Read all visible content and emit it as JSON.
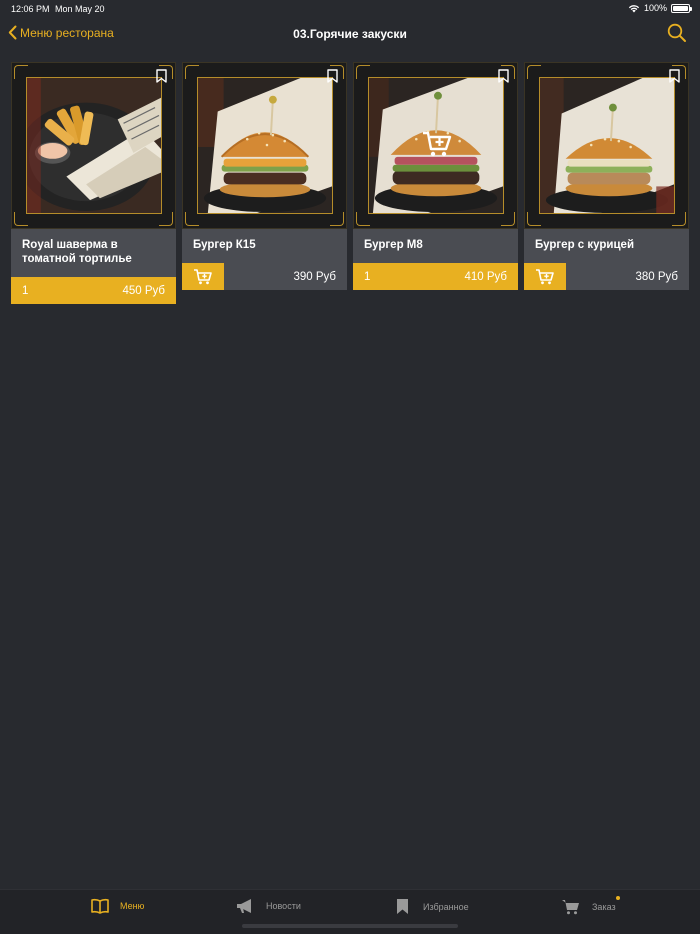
{
  "status_bar": {
    "time": "12:06 PM",
    "date": "Mon May 20",
    "battery": "100%"
  },
  "nav": {
    "back_label": "Меню ресторана",
    "title": "03.Горячие закуски"
  },
  "products": [
    {
      "name": "Royal шаверма в томатной тортилье",
      "quantity": "1",
      "price": "450 Руб",
      "in_cart": true,
      "image": "shawarma"
    },
    {
      "name": "Бургер К15",
      "quantity": "",
      "price": "390 Руб",
      "in_cart": false,
      "image": "burger"
    },
    {
      "name": "Бургер М8",
      "quantity": "1",
      "price": "410 Руб",
      "in_cart": true,
      "image": "burger"
    },
    {
      "name": "Бургер с курицей",
      "quantity": "",
      "price": "380 Руб",
      "in_cart": false,
      "image": "burger"
    }
  ],
  "tabs": [
    {
      "label": "Меню",
      "icon": "book-icon",
      "active": true
    },
    {
      "label": "Новости",
      "icon": "megaphone-icon",
      "active": false
    },
    {
      "label": "Избранное",
      "icon": "bookmark-icon",
      "active": false
    },
    {
      "label": "Заказ",
      "icon": "cart-icon",
      "active": false,
      "badge": true
    }
  ],
  "colors": {
    "accent": "#e8b021",
    "background": "#282a2f",
    "card": "#4a4c52"
  }
}
